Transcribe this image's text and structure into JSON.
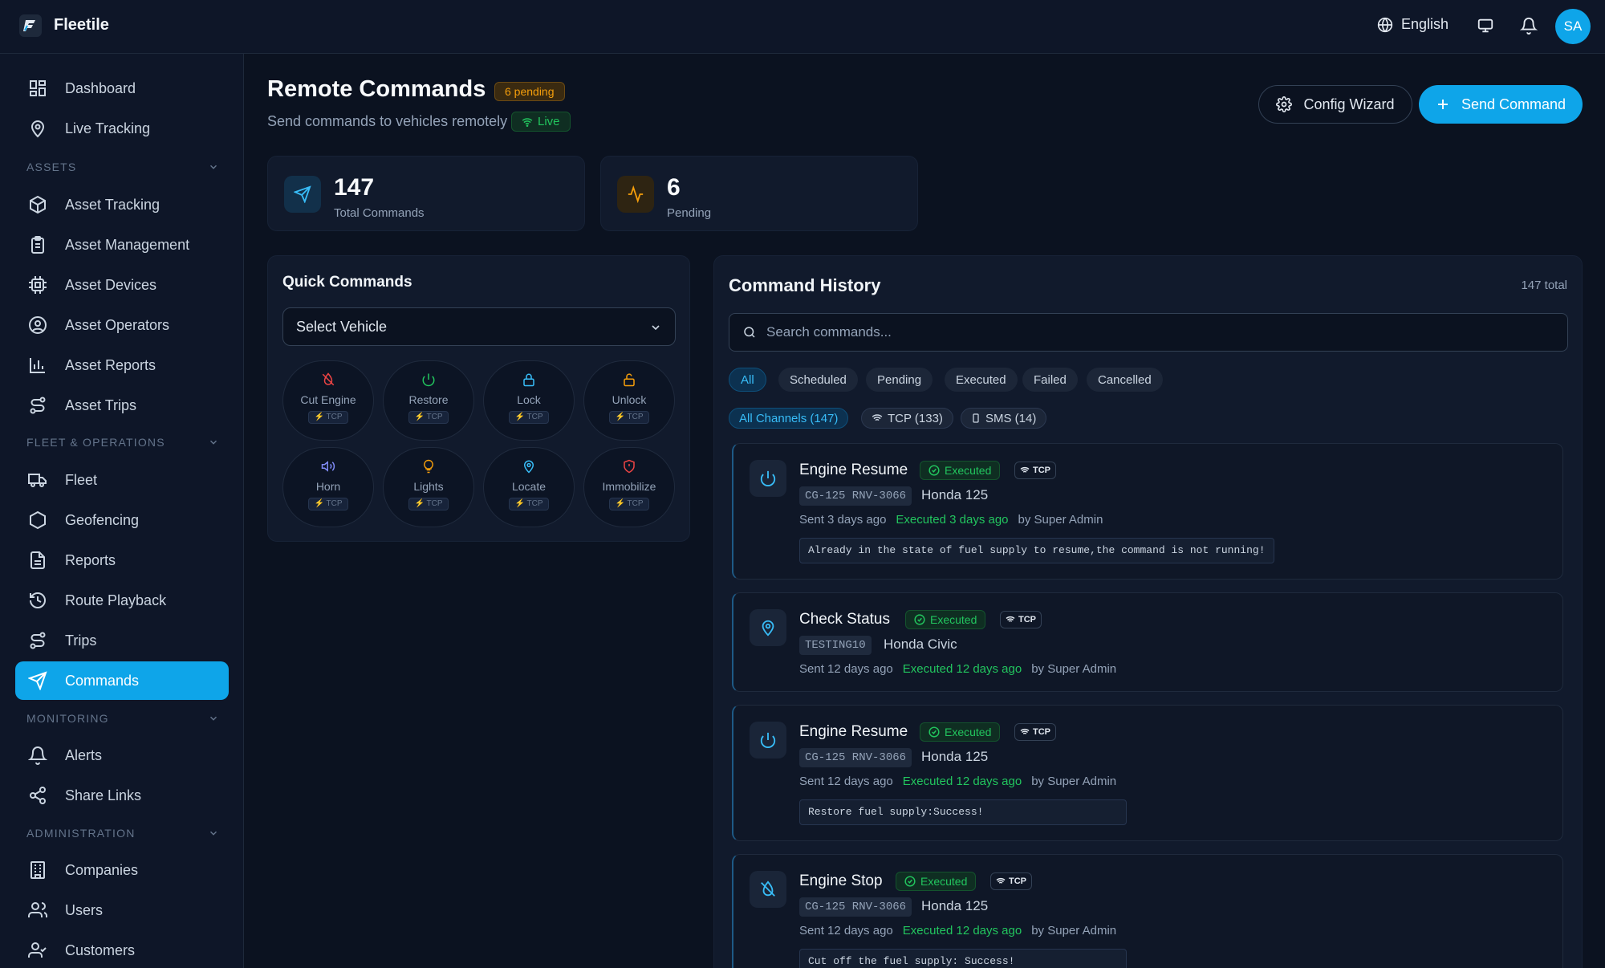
{
  "app": {
    "name": "Fleetile",
    "language": "English",
    "user_initials": "SA"
  },
  "colors": {
    "accent": "#0ea5e9",
    "success": "#22c55e",
    "warning": "#f59e0b",
    "danger": "#ef4444",
    "background": "#0b1220"
  },
  "sidebar": {
    "top": [
      {
        "label": "Dashboard",
        "icon": "grid-icon"
      },
      {
        "label": "Live Tracking",
        "icon": "map-pin-icon"
      }
    ],
    "sections": [
      {
        "title": "ASSETS",
        "items": [
          {
            "label": "Asset Tracking",
            "icon": "package-icon"
          },
          {
            "label": "Asset Management",
            "icon": "clipboard-icon"
          },
          {
            "label": "Asset Devices",
            "icon": "chip-icon"
          },
          {
            "label": "Asset Operators",
            "icon": "user-circle-icon"
          },
          {
            "label": "Asset Reports",
            "icon": "bar-chart-icon"
          },
          {
            "label": "Asset Trips",
            "icon": "route-icon"
          }
        ]
      },
      {
        "title": "FLEET & OPERATIONS",
        "items": [
          {
            "label": "Fleet",
            "icon": "truck-icon"
          },
          {
            "label": "Geofencing",
            "icon": "hexagon-icon"
          },
          {
            "label": "Reports",
            "icon": "file-text-icon"
          },
          {
            "label": "Route Playback",
            "icon": "history-icon"
          },
          {
            "label": "Trips",
            "icon": "route-icon"
          },
          {
            "label": "Commands",
            "icon": "send-icon",
            "active": true
          }
        ]
      },
      {
        "title": "MONITORING",
        "items": [
          {
            "label": "Alerts",
            "icon": "bell-icon"
          },
          {
            "label": "Share Links",
            "icon": "share-icon"
          }
        ]
      },
      {
        "title": "ADMINISTRATION",
        "items": [
          {
            "label": "Companies",
            "icon": "building-icon"
          },
          {
            "label": "Users",
            "icon": "users-icon"
          },
          {
            "label": "Customers",
            "icon": "user-check-icon"
          }
        ]
      }
    ]
  },
  "page": {
    "title": "Remote Commands",
    "pending_badge": "6 pending",
    "subtitle": "Send commands to vehicles remotely",
    "live_label": "Live",
    "config_wizard_label": "Config Wizard",
    "send_command_label": "Send Command"
  },
  "stats": [
    {
      "value": "147",
      "label": "Total Commands"
    },
    {
      "value": "6",
      "label": "Pending"
    }
  ],
  "quick_commands": {
    "title": "Quick Commands",
    "select_placeholder": "Select Vehicle",
    "items": [
      {
        "label": "Cut Engine",
        "tag": "⚡ TCP",
        "icon": "engine-off-icon",
        "color": "#ef4444"
      },
      {
        "label": "Restore",
        "tag": "⚡ TCP",
        "icon": "power-icon",
        "color": "#22c55e"
      },
      {
        "label": "Lock",
        "tag": "⚡ TCP",
        "icon": "lock-icon",
        "color": "#38bdf8"
      },
      {
        "label": "Unlock",
        "tag": "⚡ TCP",
        "icon": "unlock-icon",
        "color": "#f59e0b"
      },
      {
        "label": "Horn",
        "tag": "⚡ TCP",
        "icon": "volume-icon",
        "color": "#818cf8"
      },
      {
        "label": "Lights",
        "tag": "⚡ TCP",
        "icon": "lightbulb-icon",
        "color": "#f59e0b"
      },
      {
        "label": "Locate",
        "tag": "⚡ TCP",
        "icon": "map-pin-icon",
        "color": "#38bdf8"
      },
      {
        "label": "Immobilize",
        "tag": "⚡ TCP",
        "icon": "shield-icon",
        "color": "#ef4444"
      }
    ]
  },
  "history": {
    "title": "Command History",
    "total": "147 total",
    "search_placeholder": "Search commands...",
    "filters": [
      "All",
      "Scheduled",
      "Pending",
      "Executed",
      "Failed",
      "Cancelled"
    ],
    "channels": [
      "All Channels (147)",
      "TCP (133)",
      "SMS (14)"
    ],
    "items": [
      {
        "title": "Engine Resume",
        "status": "Executed",
        "protocol": "TCP",
        "plate": "CG-125 RNV-3066",
        "vehicle": "Honda 125",
        "sent": "Sent 3 days ago",
        "executed": "Executed 3 days ago",
        "by": "by Super Admin",
        "response": "Already in the state of fuel supply to resume,the command is not running!",
        "icon": "power-icon"
      },
      {
        "title": "Check Status",
        "status": "Executed",
        "protocol": "TCP",
        "plate": "TESTING10",
        "vehicle": "Honda Civic",
        "sent": "Sent 12 days ago",
        "executed": "Executed 12 days ago",
        "by": "by Super Admin",
        "response": "",
        "icon": "map-pin-icon"
      },
      {
        "title": "Engine Resume",
        "status": "Executed",
        "protocol": "TCP",
        "plate": "CG-125 RNV-3066",
        "vehicle": "Honda 125",
        "sent": "Sent 12 days ago",
        "executed": "Executed 12 days ago",
        "by": "by Super Admin",
        "response": "Restore fuel supply:Success!",
        "icon": "power-icon"
      },
      {
        "title": "Engine Stop",
        "status": "Executed",
        "protocol": "TCP",
        "plate": "CG-125 RNV-3066",
        "vehicle": "Honda 125",
        "sent": "Sent 12 days ago",
        "executed": "Executed 12 days ago",
        "by": "by Super Admin",
        "response": "Cut off the fuel supply: Success!",
        "icon": "engine-off-icon"
      }
    ]
  }
}
